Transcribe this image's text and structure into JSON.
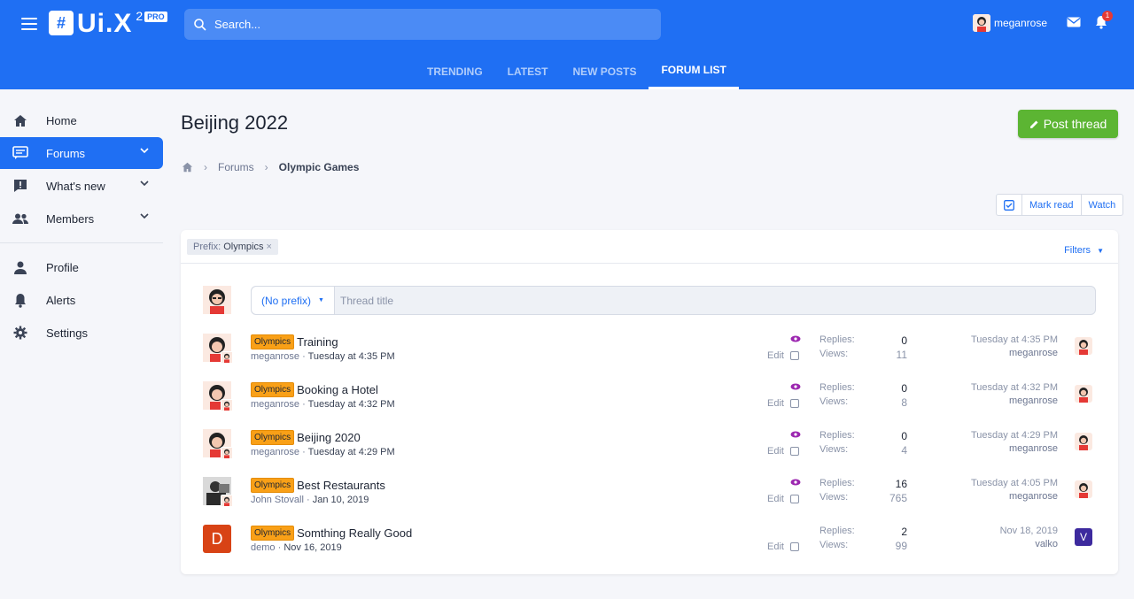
{
  "header": {
    "logo_text": "Ui.X",
    "logo_sup": "2",
    "logo_pro": "PRO",
    "search_placeholder": "Search...",
    "username": "meganrose",
    "alerts_count": "1",
    "tabs": [
      {
        "label": "TRENDING"
      },
      {
        "label": "LATEST"
      },
      {
        "label": "NEW POSTS"
      },
      {
        "label": "FORUM LIST"
      }
    ]
  },
  "sidebar": {
    "items": [
      {
        "label": "Home"
      },
      {
        "label": "Forums"
      },
      {
        "label": "What's new"
      },
      {
        "label": "Members"
      },
      {
        "label": "Profile"
      },
      {
        "label": "Alerts"
      },
      {
        "label": "Settings"
      }
    ]
  },
  "main": {
    "title": "Beijing 2022",
    "post_button": "Post thread",
    "breadcrumb": [
      "Forums",
      "Olympic Games"
    ],
    "actions": {
      "mark_read": "Mark read",
      "watch": "Watch"
    },
    "filter": {
      "prefix_label": "Prefix:",
      "prefix_value": "Olympics",
      "filters_label": "Filters"
    },
    "new_thread": {
      "prefix": "(No prefix)",
      "title_placeholder": "Thread title"
    },
    "threads": [
      {
        "prefix": "Olympics",
        "title": "Training",
        "author": "meganrose",
        "date": "Tuesday at 4:35 PM",
        "edit": "Edit",
        "replies_label": "Replies:",
        "replies": "0",
        "views_label": "Views:",
        "views": "11",
        "last_date": "Tuesday at 4:35 PM",
        "last_user": "meganrose"
      },
      {
        "prefix": "Olympics",
        "title": "Booking a Hotel",
        "author": "meganrose",
        "date": "Tuesday at 4:32 PM",
        "edit": "Edit",
        "replies_label": "Replies:",
        "replies": "0",
        "views_label": "Views:",
        "views": "8",
        "last_date": "Tuesday at 4:32 PM",
        "last_user": "meganrose"
      },
      {
        "prefix": "Olympics",
        "title": "Beijing 2020",
        "author": "meganrose",
        "date": "Tuesday at 4:29 PM",
        "edit": "Edit",
        "replies_label": "Replies:",
        "replies": "0",
        "views_label": "Views:",
        "views": "4",
        "last_date": "Tuesday at 4:29 PM",
        "last_user": "meganrose"
      },
      {
        "prefix": "Olympics",
        "title": "Best Restaurants",
        "author": "John Stovall",
        "date": "Jan 10, 2019",
        "edit": "Edit",
        "replies_label": "Replies:",
        "replies": "16",
        "views_label": "Views:",
        "views": "765",
        "last_date": "Tuesday at 4:05 PM",
        "last_user": "meganrose"
      },
      {
        "prefix": "Olympics",
        "title": "Somthing Really Good",
        "author": "demo",
        "date": "Nov 16, 2019",
        "edit": "Edit",
        "replies_label": "Replies:",
        "replies": "2",
        "views_label": "Views:",
        "views": "99",
        "last_date": "Nov 18, 2019",
        "last_user": "valko",
        "avatar_letter": "D",
        "last_avatar_letter": "V"
      }
    ]
  },
  "colors": {
    "accent": "#1f6ff3",
    "post_button": "#5cb533",
    "prefix_tag": "#f9a017",
    "watch_icon": "#9c27b0"
  }
}
